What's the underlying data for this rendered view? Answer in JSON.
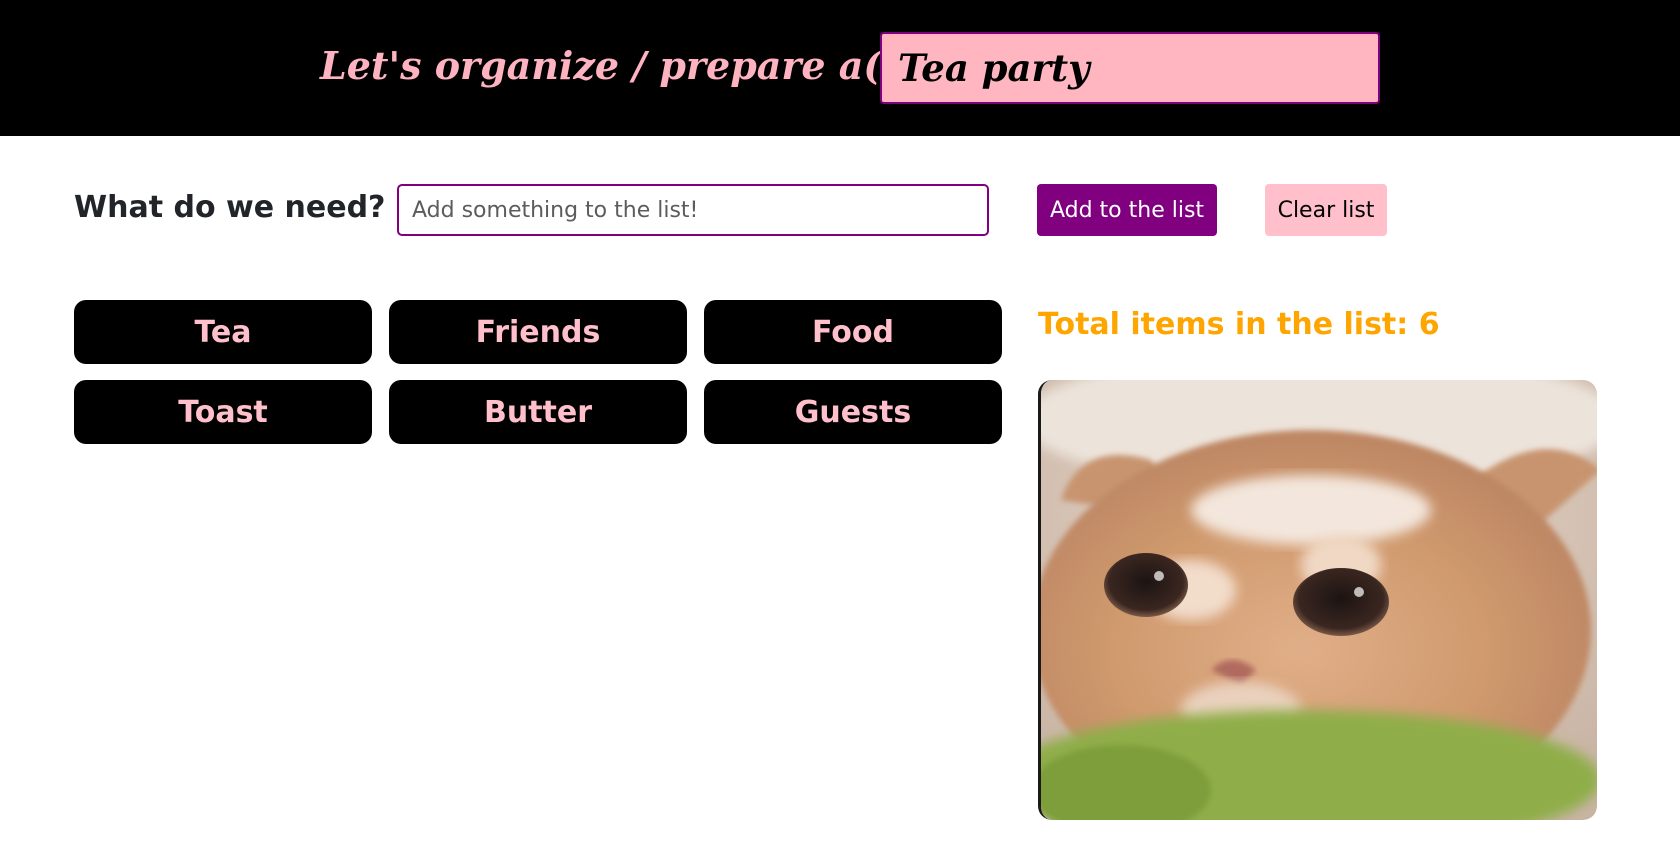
{
  "header": {
    "label": "Let's organize / prepare a(n):",
    "event_value": "Tea party"
  },
  "form": {
    "label": "What do we need?",
    "input_placeholder": "Add something to the list!",
    "add_button": "Add to the list",
    "clear_button": "Clear list"
  },
  "list": {
    "items": [
      "Tea",
      "Friends",
      "Food",
      "Toast",
      "Butter",
      "Guests"
    ],
    "total_text": "Total items in the list: 6"
  },
  "image": {
    "subject": "kitten-photo"
  },
  "colors": {
    "header_bg": "#000000",
    "header_text": "#ffb3c1",
    "event_input_bg": "#ffb6c1",
    "accent_purple": "#800080",
    "clear_button_bg": "#ffc0cb",
    "item_chip_bg": "#000000",
    "item_chip_text": "#ffc0cb",
    "total_text": "#ffa500"
  }
}
